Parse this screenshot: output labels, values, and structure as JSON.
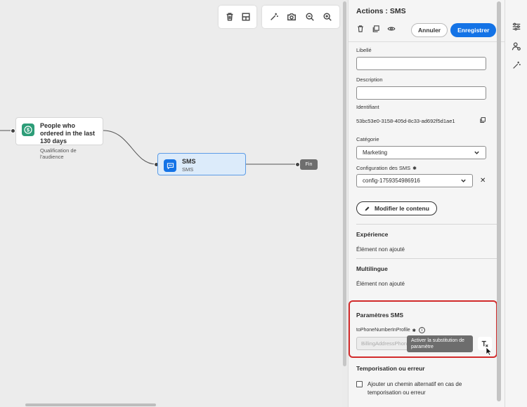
{
  "canvas": {
    "toolbar_left": [
      "trash-icon",
      "layout-icon"
    ],
    "toolbar_right": [
      "magic-wand-icon",
      "camera-icon",
      "zoom-out-icon",
      "zoom-in-icon"
    ],
    "audience_node": {
      "title": "People who ordered in the last 130 days",
      "subtitle": "Qualification de l'audience"
    },
    "sms_node": {
      "title": "SMS",
      "subtitle": "SMS"
    },
    "end_node": {
      "label": "Fin"
    }
  },
  "panel": {
    "title": "Actions : SMS",
    "cancel_label": "Annuler",
    "save_label": "Enregistrer",
    "libelle_label": "Libellé",
    "libelle_value": "",
    "description_label": "Description",
    "description_value": "",
    "identifiant_label": "Identifiant",
    "identifiant_value": "53bc53e0-3158-405d-8c33-ad692f5d1ae1",
    "categorie_label": "Catégorie",
    "categorie_value": "Marketing",
    "config_label": "Configuration des SMS",
    "config_value": "config-1759354986916",
    "edit_content_label": "Modifier le contenu",
    "experience_title": "Expérience",
    "experience_value": "Élément non ajouté",
    "multilingue_title": "Multilingue",
    "multilingue_value": "Élément non ajouté",
    "sms_params_title": "Paramètres SMS",
    "phone_label": "toPhoneNumberInProfile",
    "phone_value": "BillingAddressPhone",
    "tooltip_text": "Activer la substitution de paramètre",
    "timeout_title": "Temporisation ou erreur",
    "timeout_checkbox_label": "Ajouter un chemin alternatif en cas de temporisation ou erreur"
  },
  "colors": {
    "primary": "#1473e6",
    "highlight": "#d22b2b",
    "sms_node_bg": "#dcebfa"
  }
}
